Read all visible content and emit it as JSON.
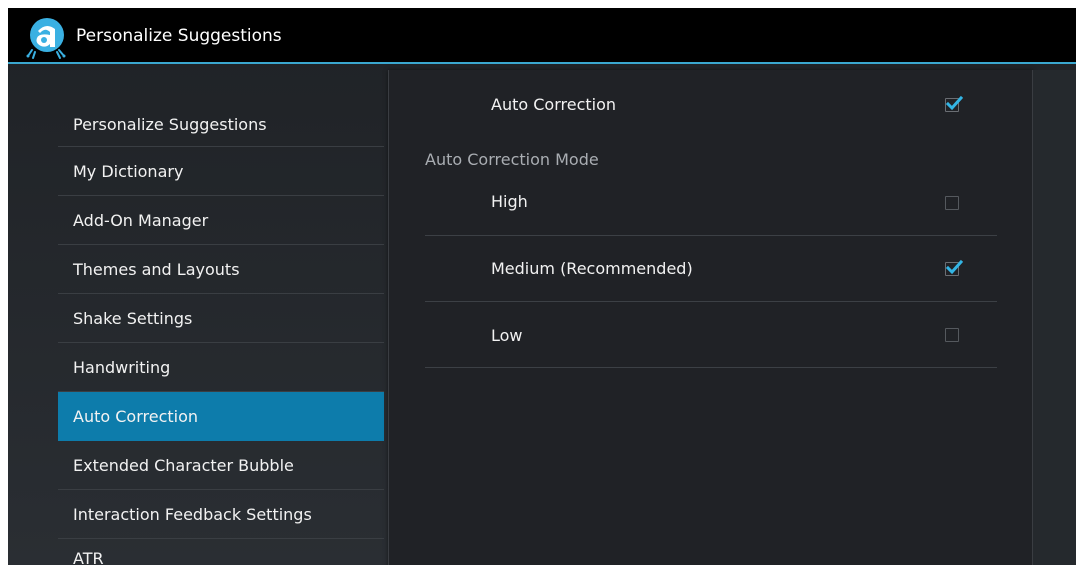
{
  "window": {
    "title": "Personalize Suggestions",
    "app_icon": "app-logo-icon"
  },
  "sidebar": {
    "items": [
      {
        "label": "Personalize Suggestions",
        "active": false
      },
      {
        "label": "My Dictionary",
        "active": false
      },
      {
        "label": "Add-On Manager",
        "active": false
      },
      {
        "label": "Themes and Layouts",
        "active": false
      },
      {
        "label": "Shake Settings",
        "active": false
      },
      {
        "label": "Handwriting",
        "active": false
      },
      {
        "label": "Auto Correction",
        "active": true
      },
      {
        "label": "Extended Character Bubble",
        "active": false
      },
      {
        "label": "Interaction Feedback Settings",
        "active": false
      },
      {
        "label": "ATR",
        "active": false
      }
    ]
  },
  "content": {
    "auto_correction": {
      "label": "Auto Correction",
      "checked": true
    },
    "mode_category": "Auto Correction Mode",
    "modes": [
      {
        "label": "High",
        "checked": false
      },
      {
        "label": "Medium (Recommended)",
        "checked": true
      },
      {
        "label": "Low",
        "checked": false
      }
    ]
  },
  "colors": {
    "accent": "#3aa7cf",
    "selected": "#0d7cab",
    "check": "#33b5e5"
  }
}
